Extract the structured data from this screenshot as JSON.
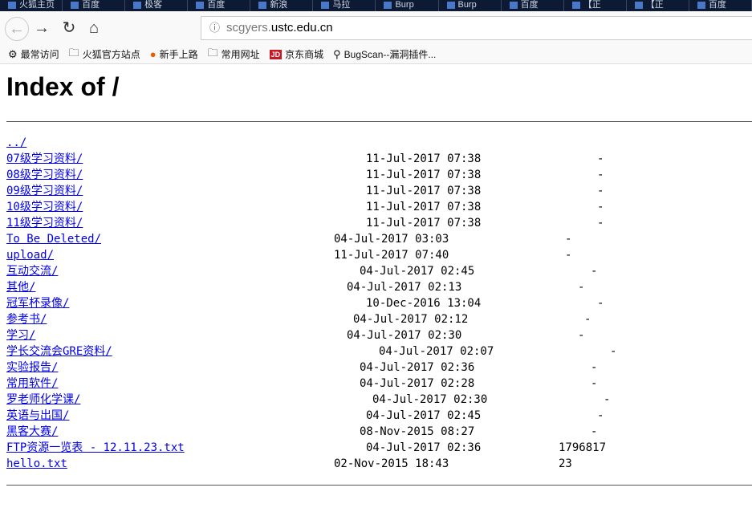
{
  "tabs": [
    "火狐主页",
    "百度",
    "极客",
    "百度",
    "新浪",
    "马拉",
    "Burp",
    "Burp",
    "百度",
    "【正",
    "【正",
    "百度"
  ],
  "nav": {
    "back": "←",
    "forward": "→",
    "reload": "↻",
    "home": "⌂",
    "info_icon": "ⓘ",
    "url_sub": "scgyers.",
    "url_domain": "ustc.edu.cn"
  },
  "bookmarks": [
    "最常访问",
    "火狐官方站点",
    "新手上路",
    "常用网址",
    "京东商城",
    "BugScan--漏洞插件..."
  ],
  "jd_logo": "JD",
  "title": "Index of /",
  "entries": [
    {
      "name": "../",
      "date": "",
      "size": ""
    },
    {
      "name": "07级学习资料/",
      "date": "11-Jul-2017 07:38",
      "size": "-"
    },
    {
      "name": "08级学习资料/",
      "date": "11-Jul-2017 07:38",
      "size": "-"
    },
    {
      "name": "09级学习资料/",
      "date": "11-Jul-2017 07:38",
      "size": "-"
    },
    {
      "name": "10级学习资料/",
      "date": "11-Jul-2017 07:38",
      "size": "-"
    },
    {
      "name": "11级学习资料/",
      "date": "11-Jul-2017 07:38",
      "size": "-"
    },
    {
      "name": "To Be Deleted/",
      "date": "04-Jul-2017 03:03",
      "size": "-"
    },
    {
      "name": "upload/",
      "date": "11-Jul-2017 07:40",
      "size": "-"
    },
    {
      "name": "互动交流/",
      "date": "04-Jul-2017 02:45",
      "size": "-"
    },
    {
      "name": "其他/",
      "date": "04-Jul-2017 02:13",
      "size": "-"
    },
    {
      "name": "冠军杯录像/",
      "date": "10-Dec-2016 13:04",
      "size": "-"
    },
    {
      "name": "参考书/",
      "date": "04-Jul-2017 02:12",
      "size": "-"
    },
    {
      "name": "学习/",
      "date": "04-Jul-2017 02:30",
      "size": "-"
    },
    {
      "name": "学长交流会GRE资料/",
      "date": "04-Jul-2017 02:07",
      "size": "-"
    },
    {
      "name": "实验报告/",
      "date": "04-Jul-2017 02:36",
      "size": "-"
    },
    {
      "name": "常用软件/",
      "date": "04-Jul-2017 02:28",
      "size": "-"
    },
    {
      "name": "罗老师化学课/",
      "date": "04-Jul-2017 02:30",
      "size": "-"
    },
    {
      "name": "英语与出国/",
      "date": "04-Jul-2017 02:45",
      "size": "-"
    },
    {
      "name": "黑客大赛/",
      "date": "08-Nov-2015 08:27",
      "size": "-"
    },
    {
      "name": "FTP资源一览表 - 12.11.23.txt",
      "date": "04-Jul-2017 02:36",
      "size": "1796817"
    },
    {
      "name": "hello.txt",
      "date": "02-Nov-2015 18:43",
      "size": "23"
    }
  ]
}
